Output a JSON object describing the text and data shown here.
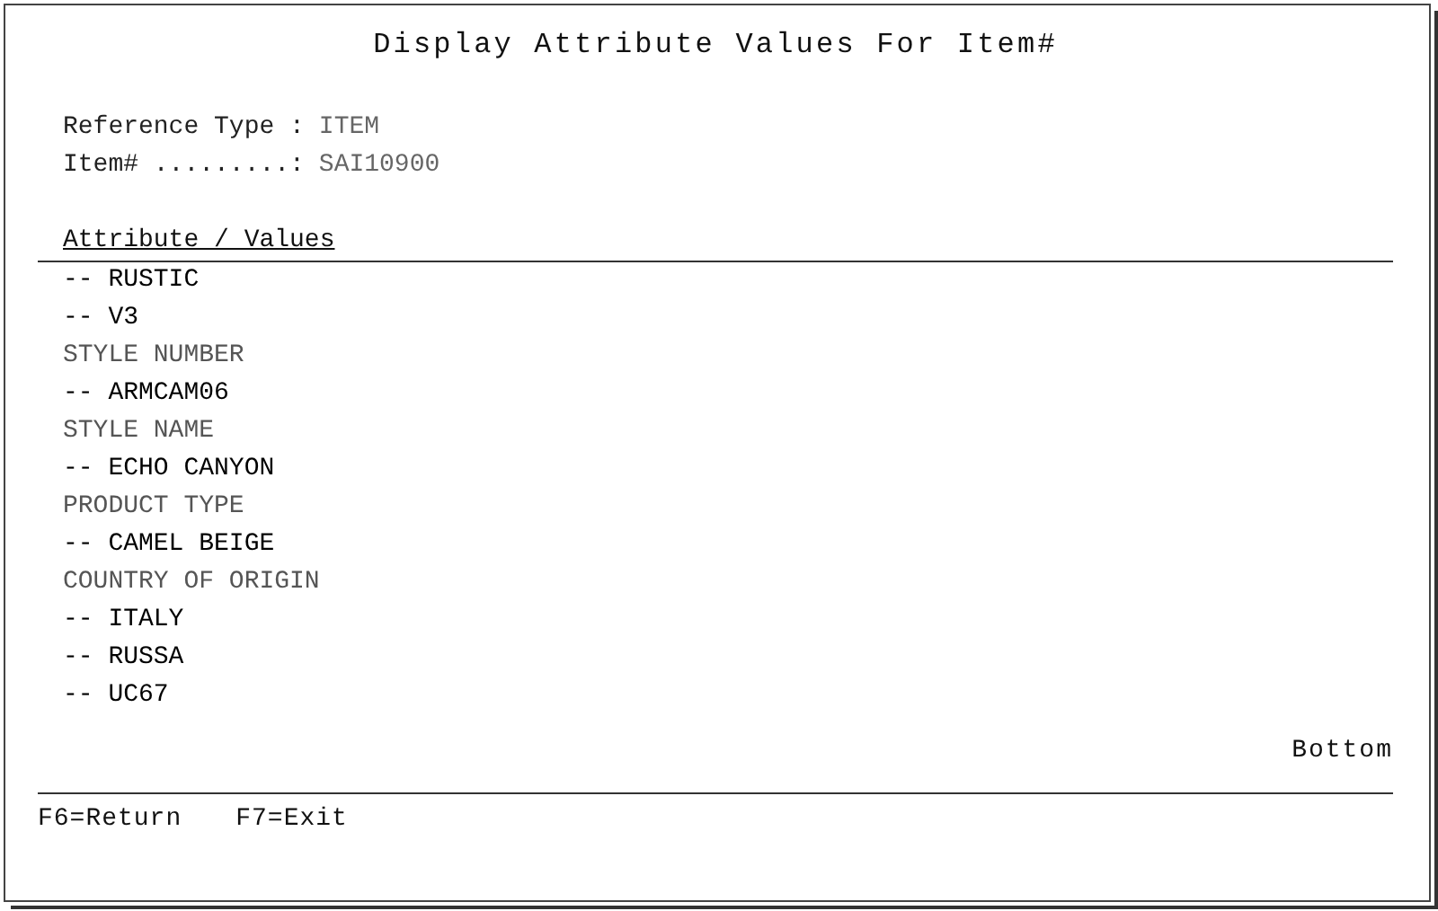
{
  "window": {
    "title": "Display Attribute Values For Item#"
  },
  "fields": [
    {
      "label": "Reference Type :",
      "value": "ITEM"
    },
    {
      "label": "Item# .........:",
      "value": "SAI10900"
    }
  ],
  "list": {
    "heading": "Attribute / Values",
    "rows": [
      {
        "kind": "value",
        "text": "-- RUSTIC"
      },
      {
        "kind": "value",
        "text": "-- V3"
      },
      {
        "kind": "attribute",
        "text": "STYLE NUMBER"
      },
      {
        "kind": "value",
        "text": "-- ARMCAM06"
      },
      {
        "kind": "attribute",
        "text": "STYLE NAME"
      },
      {
        "kind": "value",
        "text": "-- ECHO CANYON"
      },
      {
        "kind": "attribute",
        "text": "PRODUCT TYPE"
      },
      {
        "kind": "value",
        "text": "-- CAMEL BEIGE"
      },
      {
        "kind": "attribute",
        "text": "COUNTRY OF ORIGIN"
      },
      {
        "kind": "value",
        "text": "-- ITALY"
      },
      {
        "kind": "value",
        "text": "-- RUSSA"
      },
      {
        "kind": "value",
        "text": "-- UC67"
      }
    ],
    "position": "Bottom"
  },
  "function_keys": [
    "F6=Return",
    "F7=Exit"
  ]
}
